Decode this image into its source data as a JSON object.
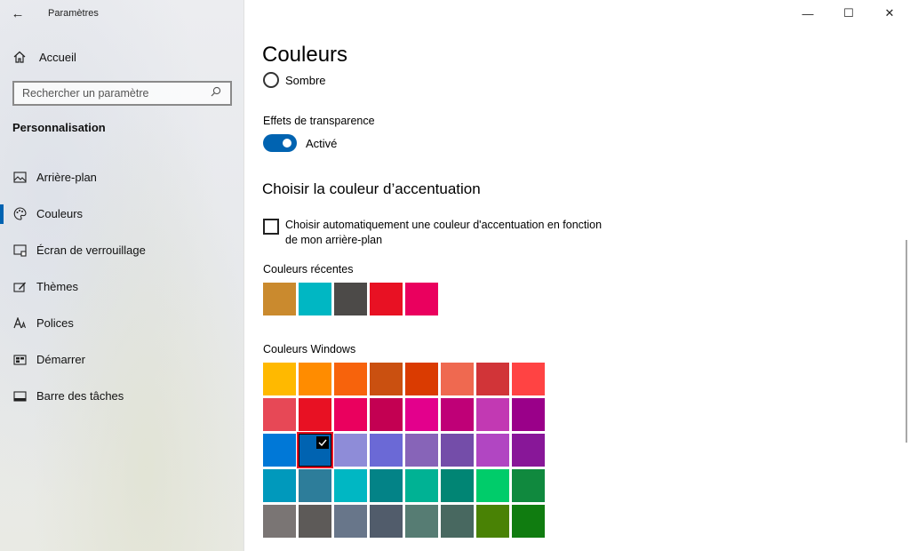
{
  "window": {
    "title": "Paramètres",
    "minimize": "—",
    "maximize": "☐",
    "close": "✕"
  },
  "sidebar": {
    "home_label": "Accueil",
    "search_placeholder": "Rechercher un paramètre",
    "section_title": "Personnalisation",
    "items": [
      {
        "label": "Arrière-plan",
        "icon": "picture-icon",
        "active": false
      },
      {
        "label": "Couleurs",
        "icon": "palette-icon",
        "active": true
      },
      {
        "label": "Écran de verrouillage",
        "icon": "lock-screen-icon",
        "active": false
      },
      {
        "label": "Thèmes",
        "icon": "themes-icon",
        "active": false
      },
      {
        "label": "Polices",
        "icon": "fonts-icon",
        "active": false
      },
      {
        "label": "Démarrer",
        "icon": "start-icon",
        "active": false
      },
      {
        "label": "Barre des tâches",
        "icon": "taskbar-icon",
        "active": false
      }
    ]
  },
  "main": {
    "title": "Couleurs",
    "mode_option": "Sombre",
    "transparency": {
      "label": "Effets de transparence",
      "state": "Activé",
      "on": true
    },
    "accent": {
      "title": "Choisir la couleur d’accentuation",
      "auto_checkbox_label": "Choisir automatiquement une couleur d'accentuation en fonction de mon arrière-plan",
      "recent_label": "Couleurs récentes",
      "recent_colors": [
        "#ca8a2e",
        "#00b7c3",
        "#4c4a48",
        "#e81123",
        "#ea005e"
      ],
      "windows_label": "Couleurs Windows",
      "windows_colors": [
        [
          "#ffb900",
          "#ff8c00",
          "#f7630c",
          "#ca5010",
          "#da3b01",
          "#ef6950",
          "#d13438",
          "#ff4343"
        ],
        [
          "#e74856",
          "#e81123",
          "#ea005e",
          "#c30052",
          "#e3008c",
          "#bf0077",
          "#c239b3",
          "#9a0089"
        ],
        [
          "#0078d7",
          "#0063b1",
          "#8e8cd8",
          "#6b69d6",
          "#8764b8",
          "#744da9",
          "#b146c2",
          "#881798"
        ],
        [
          "#0099bc",
          "#2d7d9a",
          "#00b7c3",
          "#038387",
          "#00b294",
          "#018574",
          "#00cc6a",
          "#10893e"
        ],
        [
          "#7a7574",
          "#5d5a58",
          "#68768a",
          "#515c6b",
          "#567c73",
          "#486860",
          "#498205",
          "#107c10"
        ]
      ],
      "selected": {
        "row": 2,
        "col": 1
      }
    }
  }
}
